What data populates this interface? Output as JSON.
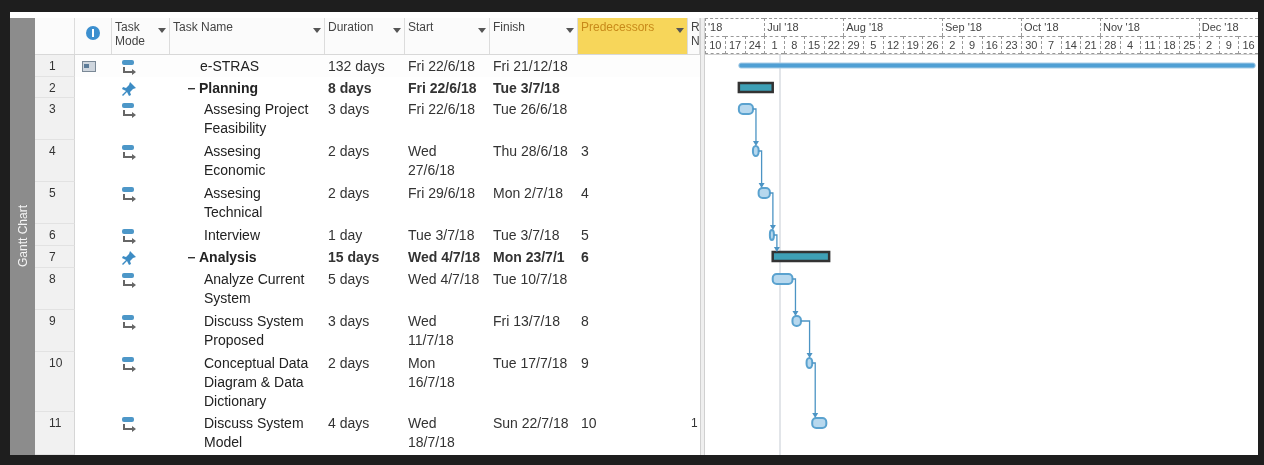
{
  "view_bar": {
    "label": "Gantt Chart"
  },
  "columns": [
    {
      "kind": "id"
    },
    {
      "kind": "info"
    },
    {
      "label": "Task Mode",
      "kind": "mode"
    },
    {
      "label": "Task Name",
      "kind": "name"
    },
    {
      "label": "Duration",
      "kind": "text"
    },
    {
      "label": "Start",
      "kind": "text"
    },
    {
      "label": "Finish",
      "kind": "text"
    },
    {
      "label": "Predecessors",
      "kind": "text",
      "selected": true
    },
    {
      "label": "R N",
      "kind": "cut"
    }
  ],
  "tasks": [
    {
      "id": "1",
      "indicator": true,
      "manual": false,
      "kind": "project",
      "name": "e-STRAS",
      "duration": "132 days",
      "start": "Fri 22/6/18",
      "finish": "Fri 21/12/18"
    },
    {
      "id": "2",
      "indicator": false,
      "manual": true,
      "kind": "summary",
      "expanded": true,
      "name": "Planning",
      "duration": "8 days",
      "start": "Fri 22/6/18",
      "finish": "Tue 3/7/18"
    },
    {
      "id": "3",
      "indicator": false,
      "manual": false,
      "kind": "task",
      "name": "Assesing Project Feasibility",
      "duration": "3 days",
      "start": "Fri 22/6/18",
      "finish": "Tue 26/6/18"
    },
    {
      "id": "4",
      "indicator": false,
      "manual": false,
      "kind": "task",
      "name": "Assesing Economic",
      "duration": "2 days",
      "start": "Wed 27/6/18",
      "finish": "Thu 28/6/18",
      "predecessors": "3"
    },
    {
      "id": "5",
      "indicator": false,
      "manual": false,
      "kind": "task",
      "name": "Assesing Technical",
      "duration": "2 days",
      "start": "Fri 29/6/18",
      "finish": "Mon 2/7/18",
      "predecessors": "4"
    },
    {
      "id": "6",
      "indicator": false,
      "manual": false,
      "kind": "task",
      "name": "Interview",
      "duration": "1 day",
      "start": "Tue 3/7/18",
      "finish": "Tue 3/7/18",
      "predecessors": "5"
    },
    {
      "id": "7",
      "indicator": false,
      "manual": true,
      "kind": "summary",
      "expanded": true,
      "name": "Analysis",
      "duration": "15 days",
      "start": "Wed 4/7/18",
      "finish": "Mon 23/7/1",
      "predecessors": "6"
    },
    {
      "id": "8",
      "indicator": false,
      "manual": false,
      "kind": "task",
      "name": "Analyze Current System",
      "duration": "5 days",
      "start": "Wed 4/7/18",
      "finish": "Tue 10/7/18"
    },
    {
      "id": "9",
      "indicator": false,
      "manual": false,
      "kind": "task",
      "name": "Discuss System Proposed",
      "duration": "3 days",
      "start": "Wed 11/7/18",
      "finish": "Fri 13/7/18",
      "predecessors": "8"
    },
    {
      "id": "10",
      "indicator": false,
      "manual": false,
      "kind": "task",
      "name": "Conceptual Data Diagram & Data Dictionary",
      "duration": "2 days",
      "start": "Mon 16/7/18",
      "finish": "Tue 17/7/18",
      "predecessors": "9"
    },
    {
      "id": "11",
      "indicator": false,
      "manual": false,
      "kind": "task",
      "name": "Discuss System Model",
      "duration": "4 days",
      "start": "Wed 18/7/18",
      "finish": "Sun 22/7/18",
      "predecessors": "10",
      "resource": "1"
    }
  ],
  "timescale": [
    {
      "label": "'18",
      "weeks": [
        "10",
        "17",
        "24"
      ]
    },
    {
      "label": "Jul '18",
      "weeks": [
        "1",
        "8",
        "15",
        "22"
      ]
    },
    {
      "label": "Aug '18",
      "weeks": [
        "29",
        "5",
        "12",
        "19",
        "26"
      ]
    },
    {
      "label": "Sep '18",
      "weeks": [
        "2",
        "9",
        "16",
        "23"
      ]
    },
    {
      "label": "Oct '18",
      "weeks": [
        "30",
        "7",
        "14",
        "21"
      ]
    },
    {
      "label": "Nov '18",
      "weeks": [
        "28",
        "4",
        "11",
        "18",
        "25"
      ]
    },
    {
      "label": "Dec '18",
      "weeks": [
        "2",
        "9",
        "16"
      ]
    }
  ]
}
